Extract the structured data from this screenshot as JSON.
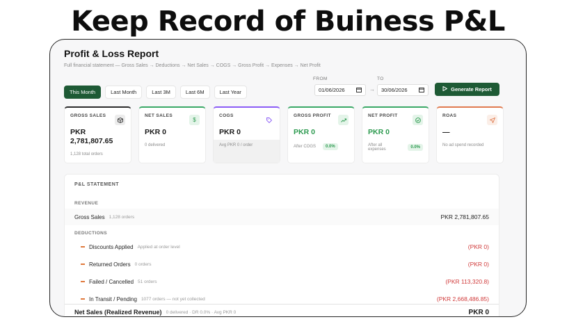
{
  "headline": "Keep Record of Buiness P&L",
  "report": {
    "title": "Profit & Loss Report",
    "subtitle": "Full financial statement — Gross Sales → Deductions → Net Sales → COGS → Gross Profit → Expenses → Net Profit"
  },
  "periods": [
    "This Month",
    "Last Month",
    "Last 3M",
    "Last 6M",
    "Last Year"
  ],
  "active_period": "This Month",
  "dates": {
    "from_label": "FROM",
    "from_value": "01/06/2026",
    "to_label": "TO",
    "to_value": "30/06/2026",
    "arrow": "→"
  },
  "generate_label": "Generate Report",
  "cards": [
    {
      "label": "GROSS SALES",
      "value": "PKR 2,781,807.65",
      "sub": "1,128 total orders",
      "pct": "",
      "icon": "cube-icon",
      "accent": "#2b2b2b"
    },
    {
      "label": "NET SALES",
      "value": "PKR 0",
      "sub": "0 delivered",
      "pct": "",
      "icon": "dollar-icon",
      "accent": "#3aa866"
    },
    {
      "label": "COGS",
      "value": "PKR 0",
      "sub": "Avg PKR 0 / order",
      "pct": "",
      "icon": "tag-icon",
      "accent": "#8b5cf6"
    },
    {
      "label": "GROSS PROFIT",
      "value": "PKR 0",
      "sub": "After COGS",
      "pct": "0.0%",
      "icon": "trend-up-icon",
      "accent": "#3aa866"
    },
    {
      "label": "NET PROFIT",
      "value": "PKR 0",
      "sub": "After all expenses",
      "pct": "0.0%",
      "icon": "check-circle-icon",
      "accent": "#3aa866"
    },
    {
      "label": "ROAS",
      "value": "—",
      "sub": "No ad spend recorded",
      "pct": "",
      "icon": "send-icon",
      "accent": "#e07a4f"
    }
  ],
  "statement": {
    "heading": "P&L STATEMENT",
    "revenue_label": "REVENUE",
    "gross_sales": {
      "label": "Gross Sales",
      "meta": "1,128 orders",
      "amount": "PKR 2,781,807.65"
    },
    "deductions_label": "DEDUCTIONS",
    "deductions": [
      {
        "label": "Discounts Applied",
        "meta": "Applied at order level",
        "amount": "(PKR 0)"
      },
      {
        "label": "Returned Orders",
        "meta": "0 orders",
        "amount": "(PKR 0)"
      },
      {
        "label": "Failed / Cancelled",
        "meta": "51 orders",
        "amount": "(PKR 113,320.8)"
      },
      {
        "label": "In Transit / Pending",
        "meta": "1077 orders — not yet collected",
        "amount": "(PKR 2,668,486.85)"
      }
    ],
    "net_sales": {
      "label": "Net Sales (Realized Revenue)",
      "meta": "0 delivered · DR 0.0% · Avg PKR 0",
      "amount": "PKR 0"
    }
  }
}
